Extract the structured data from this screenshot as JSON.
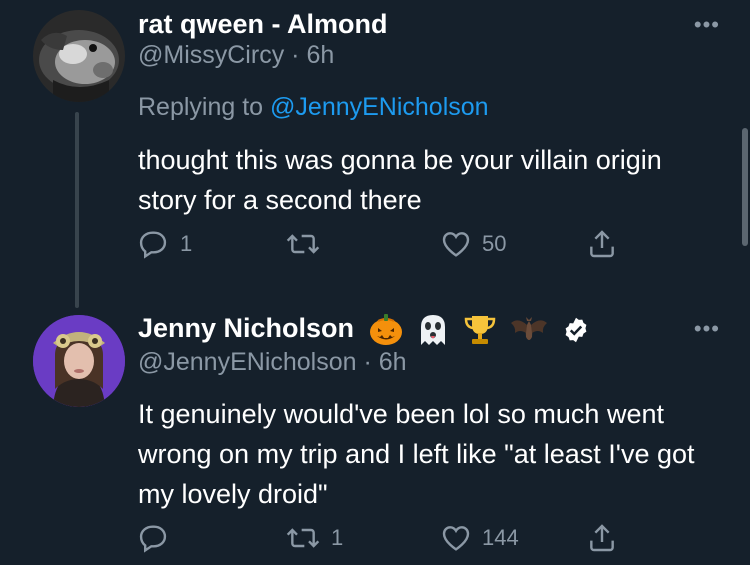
{
  "tweet1": {
    "display_name": "rat qween - Almond",
    "handle": "@MissyCircy",
    "time": "6h",
    "separator": "·",
    "replying_prefix": "Replying to",
    "replying_to": "@JennyENicholson",
    "text": "thought this was gonna be your villain origin story for a second there",
    "reply_count": "1",
    "retweet_count": "",
    "like_count": "50",
    "more_label": "•••"
  },
  "tweet2": {
    "display_name": "Jenny Nicholson",
    "handle": "@JennyENicholson",
    "time": "6h",
    "separator": "·",
    "name_emojis": [
      "jack-o-lantern",
      "ghost",
      "trophy",
      "bat"
    ],
    "verified": true,
    "text": "It genuinely would've been lol so much went wrong on my trip and I left like \"at least I've got my lovely droid\"",
    "reply_count": "",
    "retweet_count": "1",
    "like_count": "144",
    "more_label": "•••"
  },
  "colors": {
    "background": "#15202b",
    "secondary_text": "#8b98a5",
    "link": "#1d9bf0",
    "verified": "#ffffff"
  },
  "icons": [
    "reply-icon",
    "retweet-icon",
    "like-icon",
    "share-icon",
    "more-icon",
    "verified-badge-icon"
  ]
}
